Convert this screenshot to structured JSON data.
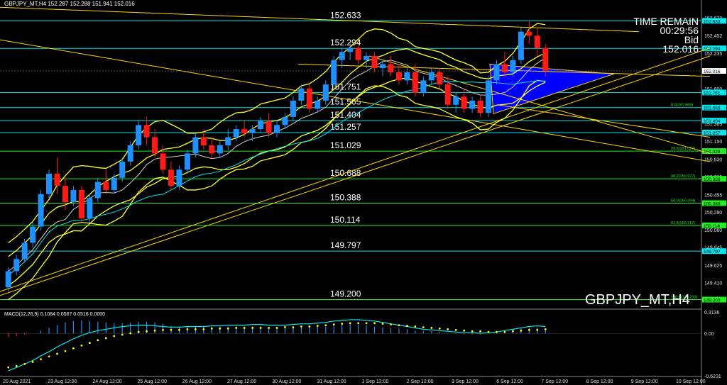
{
  "window": {
    "symbol_header": "GBPJPY_MT,H4  152.287 152.288 151.941 152.016",
    "watermark": "GBPJPY_MT,H4"
  },
  "timer": {
    "line1": "TIME REMAIN",
    "line2": "00:29:56",
    "line3": "Bid",
    "line4": "152.016"
  },
  "colors": {
    "bg": "#000000",
    "bull": "#1e90ff",
    "bear": "#ff1a1a",
    "level": "#00e5ee",
    "fib": "#22ee22",
    "trend": "#ffd700",
    "band": "#ffff33",
    "triangle": "#0000ff",
    "macd_hist": "#1e90ff",
    "macd_signal": "#ffff00",
    "macd_main": "#00e5ee"
  },
  "chart_data": [
    {
      "type": "candlestick",
      "title": "GBPJPY_MT,H4",
      "ylim": [
        149.1,
        152.82
      ],
      "y_ticks": [
        "152.670",
        "152.452",
        "152.235",
        "152.016",
        "151.800",
        "151.580",
        "151.365",
        "151.150",
        "150.930",
        "150.715",
        "150.495",
        "150.280",
        "150.060",
        "149.845",
        "149.625",
        "149.410",
        "149.190"
      ],
      "x_ticks": [
        "20 Aug 2021",
        "23 Aug 12:00",
        "24 Aug 12:00",
        "25 Aug 12:00",
        "26 Aug 12:00",
        "27 Aug 12:00",
        "30 Aug 12:00",
        "31 Aug 12:00",
        "1 Sep 12:00",
        "2 Sep 12:00",
        "3 Sep 12:00",
        "6 Sep 12:00",
        "7 Sep 12:00",
        "8 Sep 12:00",
        "9 Sep 12:00",
        "10 Sep 12:00"
      ],
      "levels": [
        {
          "label": "152.633",
          "value": 152.633,
          "kind": "level",
          "axis": "152.633"
        },
        {
          "label": "152.294",
          "value": 152.294,
          "kind": "level",
          "axis": "152.294"
        },
        {
          "label": "151.751",
          "value": 151.751,
          "kind": "level",
          "axis": "151.751"
        },
        {
          "label": "151.565",
          "value": 151.565,
          "kind": "level",
          "axis": "151.565",
          "fib": "0.0(151.565)"
        },
        {
          "label": "151.404",
          "value": 151.404,
          "kind": "level",
          "axis": "151.404"
        },
        {
          "label": "151.257",
          "value": 151.257,
          "kind": "level",
          "axis": "151.257"
        },
        {
          "label": "151.029",
          "value": 151.029,
          "kind": "fib",
          "axis": "151.029",
          "fib": "23.6(151.027)"
        },
        {
          "label": "150.688",
          "value": 150.688,
          "kind": "fib",
          "axis": "150.688",
          "fib": "38.2(150.677)"
        },
        {
          "label": "150.388",
          "value": 150.388,
          "kind": "fib",
          "axis": "150.388",
          "fib": "50.0(150.394)"
        },
        {
          "label": "150.114",
          "value": 150.114,
          "kind": "fib",
          "axis": "150.114",
          "fib": "61.8(150.112)"
        },
        {
          "label": "149.797",
          "value": 149.797,
          "kind": "level",
          "axis": "149.797"
        },
        {
          "label": "149.200",
          "value": 149.2,
          "kind": "fib",
          "axis": "149.200",
          "fib": "100.0(149.200)"
        }
      ],
      "bid": {
        "value": 152.016,
        "label": "152.016"
      },
      "candles": [
        [
          149.35,
          149.6,
          149.3,
          149.55
        ],
        [
          149.55,
          149.75,
          149.5,
          149.7
        ],
        [
          149.7,
          149.95,
          149.65,
          149.9
        ],
        [
          149.9,
          150.15,
          149.85,
          150.1
        ],
        [
          150.1,
          150.55,
          150.05,
          150.5
        ],
        [
          150.5,
          150.8,
          150.45,
          150.75
        ],
        [
          150.75,
          150.95,
          150.5,
          150.6
        ],
        [
          150.6,
          150.7,
          150.3,
          150.4
        ],
        [
          150.4,
          150.6,
          150.35,
          150.55
        ],
        [
          150.55,
          150.6,
          150.15,
          150.2
        ],
        [
          150.2,
          150.5,
          150.15,
          150.45
        ],
        [
          150.45,
          150.7,
          150.4,
          150.65
        ],
        [
          150.65,
          150.8,
          150.5,
          150.55
        ],
        [
          150.55,
          150.75,
          150.5,
          150.7
        ],
        [
          150.7,
          150.95,
          150.65,
          150.9
        ],
        [
          150.9,
          151.15,
          150.85,
          151.1
        ],
        [
          151.1,
          151.4,
          151.05,
          151.35
        ],
        [
          151.35,
          151.45,
          151.1,
          151.2
        ],
        [
          151.2,
          151.3,
          150.95,
          151.0
        ],
        [
          151.0,
          151.1,
          150.75,
          150.8
        ],
        [
          150.8,
          150.9,
          150.55,
          150.6
        ],
        [
          150.6,
          150.85,
          150.55,
          150.8
        ],
        [
          150.8,
          151.05,
          150.75,
          151.0
        ],
        [
          151.0,
          151.25,
          150.95,
          151.2
        ],
        [
          151.2,
          151.3,
          151.05,
          151.1
        ],
        [
          151.1,
          151.2,
          150.95,
          151.0
        ],
        [
          151.0,
          151.15,
          150.95,
          151.1
        ],
        [
          151.1,
          151.3,
          151.05,
          151.2
        ],
        [
          151.2,
          151.35,
          151.15,
          151.3
        ],
        [
          151.3,
          151.4,
          151.2,
          151.25
        ],
        [
          151.25,
          151.35,
          151.15,
          151.3
        ],
        [
          151.3,
          151.45,
          151.25,
          151.4
        ],
        [
          151.4,
          151.5,
          151.2,
          151.25
        ],
        [
          151.25,
          151.4,
          151.2,
          151.35
        ],
        [
          151.35,
          151.5,
          151.3,
          151.45
        ],
        [
          151.45,
          151.7,
          151.4,
          151.65
        ],
        [
          151.65,
          151.85,
          151.6,
          151.8
        ],
        [
          151.8,
          151.85,
          151.5,
          151.55
        ],
        [
          151.55,
          151.7,
          151.5,
          151.65
        ],
        [
          151.65,
          151.9,
          151.6,
          151.85
        ],
        [
          151.85,
          152.2,
          151.8,
          152.15
        ],
        [
          152.15,
          152.3,
          152.05,
          152.25
        ],
        [
          152.25,
          152.35,
          152.15,
          152.3
        ],
        [
          152.3,
          152.35,
          152.1,
          152.15
        ],
        [
          152.15,
          152.25,
          152.05,
          152.2
        ],
        [
          152.2,
          152.25,
          152.0,
          152.05
        ],
        [
          152.05,
          152.15,
          151.95,
          152.1
        ],
        [
          152.1,
          152.2,
          151.95,
          152.0
        ],
        [
          152.0,
          152.1,
          151.85,
          151.9
        ],
        [
          151.9,
          152.05,
          151.85,
          152.0
        ],
        [
          152.0,
          152.1,
          151.7,
          151.75
        ],
        [
          151.75,
          151.95,
          151.7,
          151.9
        ],
        [
          151.9,
          152.05,
          151.85,
          152.0
        ],
        [
          152.0,
          152.05,
          151.8,
          151.85
        ],
        [
          151.85,
          151.95,
          151.55,
          151.6
        ],
        [
          151.6,
          151.75,
          151.5,
          151.7
        ],
        [
          151.7,
          151.8,
          151.5,
          151.55
        ],
        [
          151.55,
          151.7,
          151.5,
          151.65
        ],
        [
          151.65,
          151.7,
          151.45,
          151.5
        ],
        [
          151.5,
          151.95,
          151.45,
          151.9
        ],
        [
          151.9,
          152.15,
          151.85,
          152.1
        ],
        [
          152.1,
          152.25,
          151.95,
          152.0
        ],
        [
          152.0,
          152.2,
          151.95,
          152.15
        ],
        [
          152.15,
          152.55,
          152.1,
          152.5
        ],
        [
          152.5,
          152.63,
          152.35,
          152.45
        ],
        [
          152.45,
          152.55,
          152.2,
          152.3
        ],
        [
          152.3,
          152.35,
          151.95,
          152.02
        ]
      ],
      "trendlines": [
        [
          [
            0,
            152.8
          ],
          [
            900,
            152.5
          ]
        ],
        [
          [
            0,
            152.4
          ],
          [
            1000,
            150.9
          ]
        ],
        [
          [
            0,
            149.3
          ],
          [
            1000,
            152.3
          ]
        ],
        [
          [
            0,
            149.25
          ],
          [
            1000,
            152.2
          ]
        ],
        [
          [
            420,
            152.1
          ],
          [
            1000,
            151.95
          ]
        ],
        [
          [
            700,
            151.6
          ],
          [
            1000,
            151.2
          ]
        ],
        [
          [
            520,
            152.2
          ],
          [
            1000,
            151.0
          ]
        ]
      ],
      "triangle": [
        [
          690,
          152.1
        ],
        [
          865,
          151.98
        ],
        [
          695,
          151.49
        ]
      ]
    },
    {
      "type": "bar+line",
      "title": "MACD(12,26,9) 0.1084 0.0567 0.0516 0.0000",
      "ylim": [
        -0.6231,
        0.3136
      ],
      "y_ticks": [
        "0.3136",
        "0.00",
        "-0.6231"
      ],
      "histogram": [
        -0.05,
        -0.04,
        -0.02,
        0.0,
        0.04,
        0.08,
        0.12,
        0.16,
        0.18,
        0.19,
        0.18,
        0.17,
        0.16,
        0.15,
        0.15,
        0.16,
        0.17,
        0.17,
        0.16,
        0.14,
        0.11,
        0.1,
        0.1,
        0.11,
        0.11,
        0.1,
        0.1,
        0.1,
        0.1,
        0.1,
        0.1,
        0.1,
        0.09,
        0.09,
        0.09,
        0.1,
        0.11,
        0.1,
        0.1,
        0.1,
        0.12,
        0.13,
        0.14,
        0.13,
        0.12,
        0.1,
        0.09,
        0.08,
        0.07,
        0.06,
        0.04,
        0.03,
        0.03,
        0.02,
        0.0,
        -0.01,
        -0.02,
        -0.02,
        -0.02,
        0.0,
        0.02,
        0.04,
        0.05,
        0.07,
        0.08,
        0.08,
        0.07
      ],
      "signal": [
        -0.5,
        -0.48,
        -0.45,
        -0.42,
        -0.38,
        -0.34,
        -0.3,
        -0.26,
        -0.22,
        -0.18,
        -0.14,
        -0.1,
        -0.07,
        -0.04,
        -0.02,
        0.0,
        0.02,
        0.03,
        0.04,
        0.05,
        0.05,
        0.05,
        0.06,
        0.06,
        0.06,
        0.07,
        0.07,
        0.07,
        0.08,
        0.08,
        0.08,
        0.08,
        0.08,
        0.08,
        0.09,
        0.09,
        0.1,
        0.1,
        0.11,
        0.12,
        0.13,
        0.14,
        0.15,
        0.15,
        0.15,
        0.15,
        0.14,
        0.13,
        0.12,
        0.11,
        0.1,
        0.09,
        0.08,
        0.07,
        0.06,
        0.05,
        0.04,
        0.03,
        0.03,
        0.02,
        0.02,
        0.02,
        0.03,
        0.04,
        0.05,
        0.05,
        0.06
      ],
      "main": [
        -0.55,
        -0.5,
        -0.45,
        -0.4,
        -0.33,
        -0.27,
        -0.2,
        -0.14,
        -0.08,
        -0.03,
        0.01,
        0.04,
        0.06,
        0.08,
        0.1,
        0.11,
        0.12,
        0.12,
        0.11,
        0.1,
        0.09,
        0.09,
        0.1,
        0.1,
        0.1,
        0.11,
        0.11,
        0.12,
        0.12,
        0.12,
        0.13,
        0.13,
        0.12,
        0.12,
        0.12,
        0.13,
        0.14,
        0.14,
        0.15,
        0.16,
        0.18,
        0.19,
        0.2,
        0.2,
        0.19,
        0.18,
        0.16,
        0.14,
        0.12,
        0.1,
        0.08,
        0.06,
        0.05,
        0.04,
        0.03,
        0.02,
        0.01,
        0.01,
        0.0,
        0.01,
        0.02,
        0.04,
        0.06,
        0.08,
        0.1,
        0.11,
        0.1
      ]
    }
  ]
}
